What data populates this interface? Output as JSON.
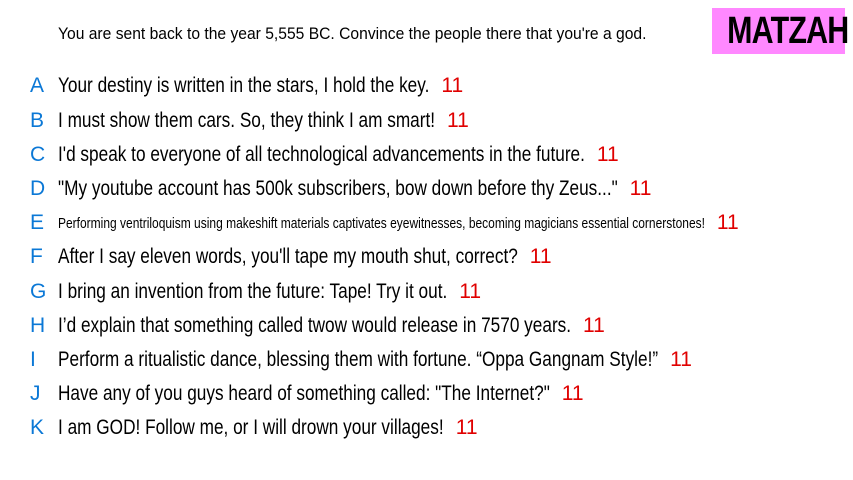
{
  "prompt": "You are sent back to the year 5,555 BC. Convince the people there that you're a god.",
  "brand": "MATZAH",
  "colors": {
    "brand_bg": "#ff88ff",
    "letter": "#0b78d6",
    "score": "#e00000"
  },
  "responses": [
    {
      "letter": "A",
      "text": "Your destiny is written in the stars, I hold the key.",
      "score": "11"
    },
    {
      "letter": "B",
      "text": "I must show them cars. So, they think I am smart!",
      "score": "11"
    },
    {
      "letter": "C",
      "text": "I'd speak to everyone of all technological advancements in the future.",
      "score": "11"
    },
    {
      "letter": "D",
      "text": "\"My youtube account has 500k subscribers, bow down before thy Zeus...\"",
      "score": "11"
    },
    {
      "letter": "E",
      "text": "Performing ventriloquism using makeshift materials captivates eyewitnesses, becoming magicians essential cornerstones!",
      "score": "11"
    },
    {
      "letter": "F",
      "text": "After I say eleven words, you'll tape my mouth shut, correct?",
      "score": "11"
    },
    {
      "letter": "G",
      "text": "I bring an invention from the future: Tape! Try it out.",
      "score": "11"
    },
    {
      "letter": "H",
      "text": "I’d explain that something called twow would release in 7570 years.",
      "score": "11"
    },
    {
      "letter": "I",
      "text": "Perform a ritualistic dance, blessing them with fortune. “Oppa Gangnam Style!”",
      "score": "11"
    },
    {
      "letter": "J",
      "text": "Have any of you guys heard of something called: \"The Internet?\"",
      "score": "11"
    },
    {
      "letter": "K",
      "text": "I am GOD! Follow me, or I will drown your villages!",
      "score": "11"
    }
  ]
}
